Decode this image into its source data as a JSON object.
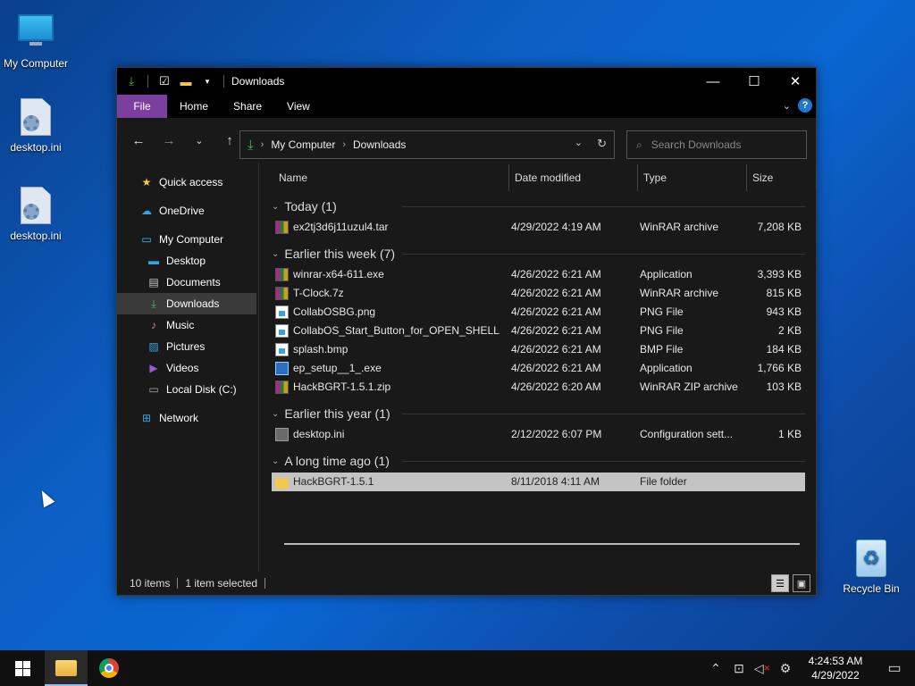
{
  "desktop": {
    "icons": [
      {
        "label": "My Computer",
        "icon": "computer-icon"
      },
      {
        "label": "desktop.ini",
        "icon": "config-file-icon"
      },
      {
        "label": "desktop.ini",
        "icon": "config-file-icon"
      },
      {
        "label": "Recycle Bin",
        "icon": "recycle-bin-icon"
      }
    ]
  },
  "window": {
    "title": "Downloads",
    "ribbon_tabs": [
      "File",
      "Home",
      "Share",
      "View"
    ],
    "accent": "#7b3fa0",
    "address": {
      "crumbs": [
        "My Computer",
        "Downloads"
      ]
    },
    "search": {
      "placeholder": "Search Downloads"
    },
    "nav": {
      "items": [
        {
          "label": "Quick access",
          "icon": "star-icon"
        },
        {
          "label": "OneDrive",
          "icon": "cloud-icon"
        },
        {
          "label": "My Computer",
          "icon": "computer-icon"
        },
        {
          "label": "Desktop",
          "icon": "desktop-folder-icon"
        },
        {
          "label": "Documents",
          "icon": "documents-icon"
        },
        {
          "label": "Downloads",
          "icon": "download-icon",
          "selected": true
        },
        {
          "label": "Music",
          "icon": "music-icon"
        },
        {
          "label": "Pictures",
          "icon": "pictures-icon"
        },
        {
          "label": "Videos",
          "icon": "videos-icon"
        },
        {
          "label": "Local Disk (C:)",
          "icon": "disk-icon"
        },
        {
          "label": "Network",
          "icon": "network-icon"
        }
      ]
    },
    "columns": [
      "Name",
      "Date modified",
      "Type",
      "Size"
    ],
    "groups": [
      {
        "label": "Today (1)",
        "files": [
          {
            "name": "ex2tj3d6j11uzul4.tar",
            "date": "4/29/2022 4:19 AM",
            "type": "WinRAR archive",
            "size": "7,208 KB",
            "icon": "archive-icon"
          }
        ]
      },
      {
        "label": "Earlier this week (7)",
        "files": [
          {
            "name": "winrar-x64-611.exe",
            "date": "4/26/2022 6:21 AM",
            "type": "Application",
            "size": "3,393 KB",
            "icon": "archive-icon"
          },
          {
            "name": "T-Clock.7z",
            "date": "4/26/2022 6:21 AM",
            "type": "WinRAR archive",
            "size": "815 KB",
            "icon": "archive-icon"
          },
          {
            "name": "CollabOSBG.png",
            "date": "4/26/2022 6:21 AM",
            "type": "PNG File",
            "size": "943 KB",
            "icon": "image-file-icon"
          },
          {
            "name": "CollabOS_Start_Button_for_OPEN_SHELL....",
            "date": "4/26/2022 6:21 AM",
            "type": "PNG File",
            "size": "2 KB",
            "icon": "image-file-icon"
          },
          {
            "name": "splash.bmp",
            "date": "4/26/2022 6:21 AM",
            "type": "BMP File",
            "size": "184 KB",
            "icon": "image-file-icon"
          },
          {
            "name": "ep_setup__1_.exe",
            "date": "4/26/2022 6:21 AM",
            "type": "Application",
            "size": "1,766 KB",
            "icon": "exe-icon"
          },
          {
            "name": "HackBGRT-1.5.1.zip",
            "date": "4/26/2022 6:20 AM",
            "type": "WinRAR ZIP archive",
            "size": "103 KB",
            "icon": "archive-icon"
          }
        ]
      },
      {
        "label": "Earlier this year (1)",
        "files": [
          {
            "name": "desktop.ini",
            "date": "2/12/2022 6:07 PM",
            "type": "Configuration sett...",
            "size": "1 KB",
            "icon": "config-file-icon"
          }
        ]
      },
      {
        "label": "A long time ago (1)",
        "files": [
          {
            "name": "HackBGRT-1.5.1",
            "date": "8/11/2018 4:11 AM",
            "type": "File folder",
            "size": "",
            "icon": "folder-icon",
            "selected": true
          }
        ]
      }
    ],
    "status": {
      "items": "10 items",
      "selected": "1 item selected"
    }
  },
  "taskbar": {
    "clock_time": "4:24:53 AM",
    "clock_date": "4/29/2022"
  }
}
